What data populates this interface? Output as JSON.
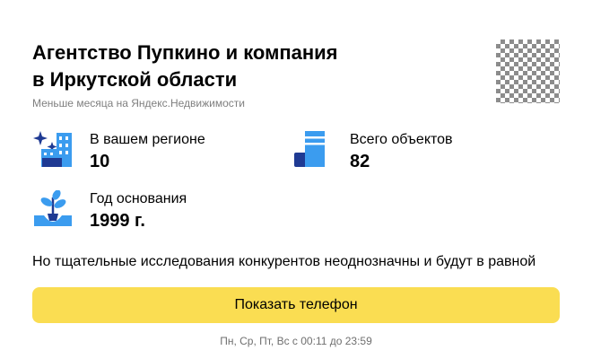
{
  "header": {
    "title_line1": "Агентство Пупкино и компания",
    "title_line2": "в Иркутской области",
    "subtitle": "Меньше месяца на Яндекс.Недвижимости"
  },
  "stats": {
    "region": {
      "label": "В вашем регионе",
      "value": "10",
      "icon": "city-sparkle-icon"
    },
    "objects": {
      "label": "Всего объектов",
      "value": "82",
      "icon": "building-icon"
    },
    "founded": {
      "label": "Год основания",
      "value": "1999 г.",
      "icon": "sprout-icon"
    }
  },
  "description": "Но тщательные исследования конкурентов неоднозначны и будут в равной",
  "phone_button": {
    "label": "Показать телефон",
    "color": "#fadd52"
  },
  "hours": "Пн, Ср, Пт, Вс с 00:11 до 23:59",
  "colors": {
    "icon_blue": "#3b9cef",
    "icon_navy": "#1f3a93",
    "accent_yellow": "#fadd52"
  }
}
